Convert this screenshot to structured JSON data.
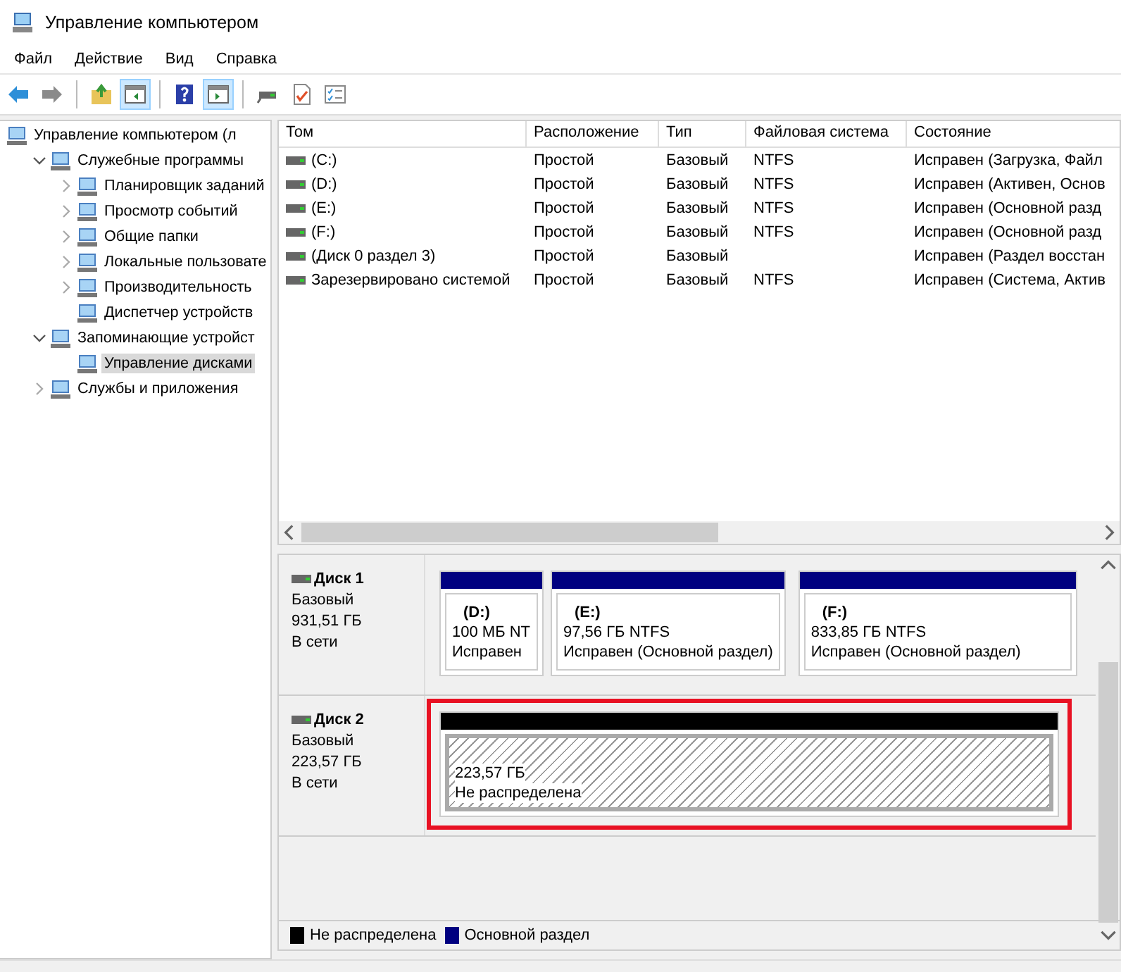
{
  "window": {
    "title": "Управление компьютером"
  },
  "menu": [
    "Файл",
    "Действие",
    "Вид",
    "Справка"
  ],
  "toolbar": [
    {
      "pressed": false
    },
    {
      "pressed": false
    },
    {
      "pressed": false
    },
    {
      "pressed": true
    },
    {
      "pressed": false
    },
    {
      "pressed": true
    },
    {
      "pressed": false
    },
    {
      "pressed": false
    },
    {
      "pressed": false
    }
  ],
  "tree": [
    {
      "label": "Управление компьютером (л",
      "selected": false,
      "children": [
        {
          "label": "Служебные программы",
          "expanded": true,
          "selected": false,
          "children": [
            {
              "label": "Планировщик заданий",
              "expanded": false,
              "selected": false
            },
            {
              "label": "Просмотр событий",
              "expanded": false,
              "selected": false
            },
            {
              "label": "Общие папки",
              "expanded": false,
              "selected": false
            },
            {
              "label": "Локальные пользовате",
              "expanded": false,
              "selected": false
            },
            {
              "label": "Производительность",
              "expanded": false,
              "selected": false
            },
            {
              "label": "Диспетчер устройств",
              "selected": false
            }
          ]
        },
        {
          "label": "Запоминающие устройст",
          "expanded": true,
          "selected": false,
          "children": [
            {
              "label": "Управление дисками",
              "selected": true
            }
          ]
        },
        {
          "label": "Службы и приложения",
          "expanded": false,
          "selected": false
        }
      ]
    }
  ],
  "table": {
    "columns": [
      "Том",
      "Расположение",
      "Тип",
      "Файловая система",
      "Состояние"
    ],
    "rows": [
      [
        "(C:)",
        "Простой",
        "Базовый",
        "NTFS",
        "Исправен (Загрузка, Файл"
      ],
      [
        "(D:)",
        "Простой",
        "Базовый",
        "NTFS",
        "Исправен (Активен, Основ"
      ],
      [
        "(E:)",
        "Простой",
        "Базовый",
        "NTFS",
        "Исправен (Основной разд"
      ],
      [
        "(F:)",
        "Простой",
        "Базовый",
        "NTFS",
        "Исправен (Основной разд"
      ],
      [
        "(Диск 0 раздел 3)",
        "Простой",
        "Базовый",
        "",
        "Исправен (Раздел восстан"
      ],
      [
        "Зарезервировано системой",
        "Простой",
        "Базовый",
        "NTFS",
        "Исправен (Система, Актив"
      ]
    ]
  },
  "disks": [
    {
      "name": "Диск 1",
      "type": "Базовый",
      "size": "931,51 ГБ",
      "status": "В сети",
      "partitions": [
        {
          "kind": "primary",
          "color": "#000080",
          "highlighted": false,
          "label": "(D:)",
          "size": "100 МБ NT",
          "status": "Исправен"
        },
        {
          "kind": "primary",
          "color": "#000080",
          "highlighted": false,
          "label": "(E:)",
          "size": "97,56 ГБ NTFS",
          "status": "Исправен (Основной раздел)"
        },
        {
          "kind": "primary",
          "color": "#000080",
          "highlighted": false,
          "label": "(F:)",
          "size": "833,85 ГБ NTFS",
          "status": "Исправен (Основной раздел)"
        }
      ]
    },
    {
      "name": "Диск 2",
      "type": "Базовый",
      "size": "223,57 ГБ",
      "status": "В сети",
      "partitions": [
        {
          "kind": "unallocated",
          "color": "#000000",
          "highlighted": true,
          "size": "223,57 ГБ",
          "status": "Не распределена"
        }
      ]
    }
  ],
  "legend": [
    {
      "label": "Не распределена",
      "color": "#000000"
    },
    {
      "label": "Основной раздел",
      "color": "#000080"
    }
  ]
}
